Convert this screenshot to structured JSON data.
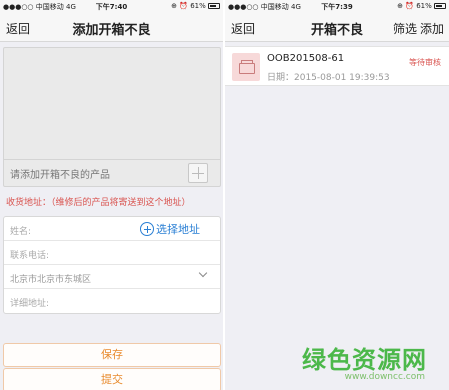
{
  "status_left": {
    "carrier": "●●●○○ 中国移动  4G",
    "time": "下午7:40",
    "right": "⊕ ⏰ 61%"
  },
  "status_right": {
    "carrier": "●●●○○ 中国移动  4G",
    "time": "下午7:39",
    "right": "⊕ ⏰ 61%"
  },
  "left_screen": {
    "nav": {
      "back_label": "返回",
      "title": "添加开箱不良"
    },
    "photo_hint": "请添加开箱不良的产品",
    "address_note": "收货地址：（维修后的产品将寄送到这个地址）",
    "form": {
      "name_placeholder": "姓名:",
      "select_address_label": "选择地址",
      "phone_placeholder": "联系电话:",
      "region_value": "北京市北京市东城区",
      "detail_placeholder": "详细地址:"
    },
    "buttons": {
      "save_label": "保存",
      "submit_label": "提交"
    }
  },
  "right_screen": {
    "nav": {
      "back_label": "返回",
      "title": "开箱不良",
      "filter_label": "筛选",
      "add_label": "添加"
    },
    "orders": [
      {
        "order_no": "OOB201508-61",
        "date": "日期：2015-08-01 19:39:53",
        "status": "等待审核"
      }
    ]
  },
  "watermark": {
    "main": "绿色资源网",
    "url": "www.downcc.com"
  },
  "colors": {
    "accent_blue": "#2a7fd4",
    "alert_red": "#d9534f",
    "button_orange": "#e88a2c",
    "watermark_green": "#4cb84a"
  }
}
